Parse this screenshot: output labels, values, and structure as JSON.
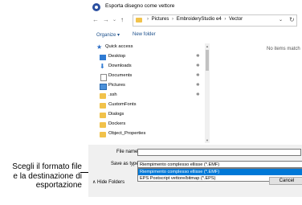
{
  "callout": {
    "line1": "Scegli il formato file",
    "line2": "e la destinazione di",
    "line3": "esportazione"
  },
  "window": {
    "title": "Esporta disegno come vettore"
  },
  "nav": {
    "back": "←",
    "forward": "→",
    "recent": "⌄",
    "up": "↑"
  },
  "address": {
    "crumbs": [
      "Pictures",
      "EmbroideryStudio e4",
      "Vector"
    ],
    "separator": "›",
    "chevron": "⌄",
    "refresh": "↻"
  },
  "toolbar": {
    "organize": "Organize ▾",
    "new_folder": "New folder"
  },
  "sidebar": {
    "items": [
      {
        "label": "Quick access",
        "icon": "star-icon",
        "pinned": false
      },
      {
        "label": "Desktop",
        "icon": "desktop-icon",
        "pinned": true
      },
      {
        "label": "Downloads",
        "icon": "download-icon",
        "pinned": true
      },
      {
        "label": "Documents",
        "icon": "document-icon",
        "pinned": true
      },
      {
        "label": "Pictures",
        "icon": "pictures-icon",
        "pinned": true
      },
      {
        "label": ".ssh",
        "icon": "folder-icon",
        "pinned": true
      },
      {
        "label": "CustomFonts",
        "icon": "folder-icon",
        "pinned": false
      },
      {
        "label": "Dialogs",
        "icon": "folder-icon",
        "pinned": false
      },
      {
        "label": "Dockers",
        "icon": "folder-icon",
        "pinned": false
      },
      {
        "label": "Object_Properties",
        "icon": "folder-icon",
        "pinned": false
      }
    ],
    "pin_glyph": "✱"
  },
  "content": {
    "empty_message": "No items match"
  },
  "form": {
    "file_name_label": "File name:",
    "file_name_value": "",
    "save_type_label": "Save as type:",
    "save_type_selected": "Riempimento complesso ellisse (*.EMF)",
    "options": [
      "Riempimento complesso ellisse (*.EMF)",
      "EPS Postscript vettore/bitmap (*.EPS)"
    ]
  },
  "footer": {
    "hide_folders": "∧  Hide Folders",
    "cancel": "Cancel"
  },
  "colors": {
    "accent": "#0078d7",
    "folder": "#f1c24b",
    "link": "#1a4e8a"
  }
}
